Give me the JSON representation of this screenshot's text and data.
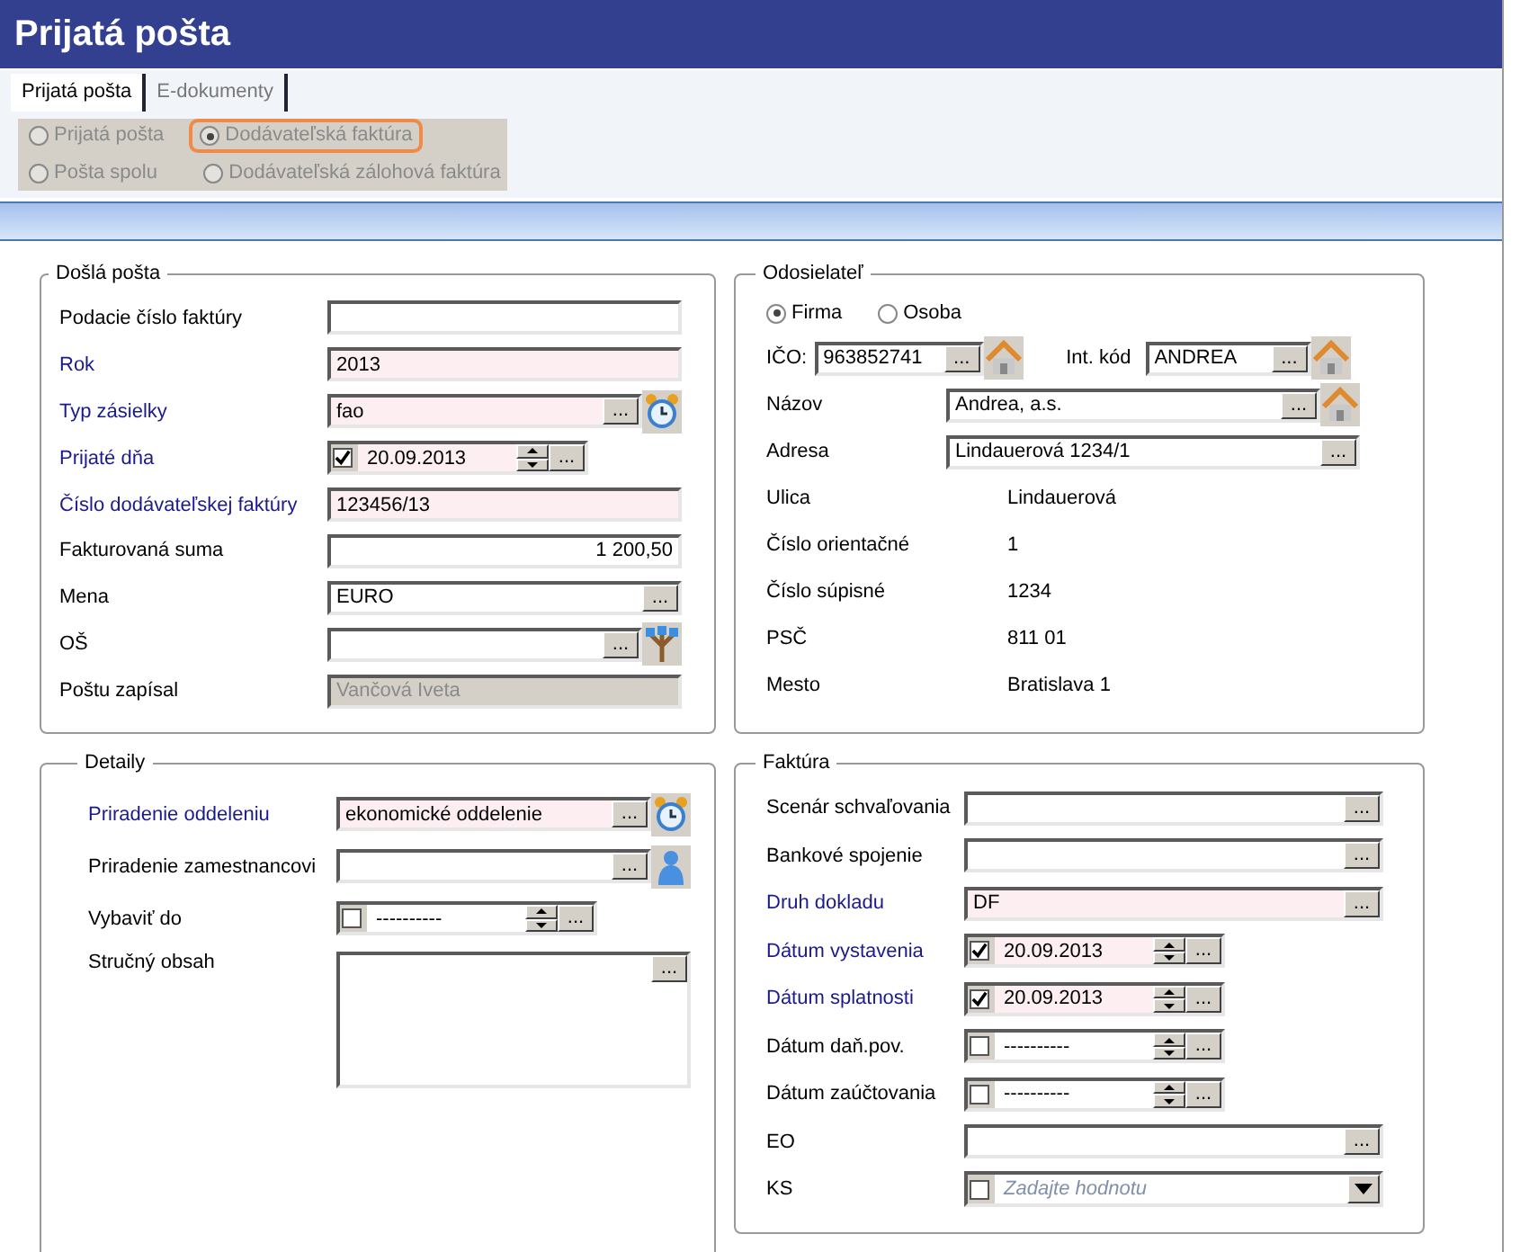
{
  "window": {
    "title": "Prijatá pošta"
  },
  "tabs": [
    {
      "label": "Prijatá pošta",
      "selected": true
    },
    {
      "label": "E-dokumenty",
      "selected": false
    }
  ],
  "doc_types": [
    {
      "label": "Prijatá pošta",
      "selected": false,
      "disabled": true,
      "highlighted": false
    },
    {
      "label": "Dodávateľská faktúra",
      "selected": true,
      "disabled": true,
      "highlighted": true
    },
    {
      "label": "Pošta spolu",
      "selected": false,
      "disabled": true,
      "highlighted": false
    },
    {
      "label": "Dodávateľská zálohová faktúra",
      "selected": false,
      "disabled": true,
      "highlighted": false
    }
  ],
  "panels": [
    {
      "kind": "dosla",
      "title": "Došlá pošta",
      "fields": [
        {
          "kind": "text",
          "label": "Podacie číslo faktúry",
          "required": false
        },
        {
          "kind": "text",
          "label": "Rok",
          "value": "2013",
          "required": true
        },
        {
          "kind": "lookup",
          "label": "Typ zásielky",
          "value": "fao",
          "required": true,
          "button": "..."
        },
        {
          "kind": "date",
          "label": "Prijaté dňa",
          "value": "20.09.2013",
          "checked": true,
          "required": true,
          "button": "..."
        },
        {
          "kind": "text",
          "label": "Číslo dodávateľskej faktúry",
          "value": "123456/13",
          "required": true
        },
        {
          "kind": "amount",
          "label": "Fakturovaná suma",
          "value": "1 200,50",
          "required": false
        },
        {
          "kind": "lookup",
          "label": "Mena",
          "value": "EURO",
          "required": false,
          "button": "..."
        },
        {
          "kind": "lookup",
          "label": "OŠ",
          "required": false,
          "button": "..."
        },
        {
          "kind": "readonly",
          "label": "Poštu zapísal",
          "value": "Vančová Iveta",
          "required": false
        }
      ]
    },
    {
      "kind": "odosielatel",
      "title": "Odosielateľ",
      "fields": [
        {
          "kind": "radios",
          "options": [
            {
              "label": "Firma",
              "selected": true
            },
            {
              "label": "Osoba",
              "selected": false
            }
          ]
        },
        {
          "kind": "pair",
          "items": [
            {
              "label": "IČO:",
              "value": "963852741",
              "button": "..."
            },
            {
              "label": "Int. kód",
              "value": "ANDREA",
              "button": "..."
            }
          ]
        },
        {
          "kind": "lookup",
          "label": "Názov",
          "value": "Andrea, a.s.",
          "required": false,
          "button": "..."
        },
        {
          "kind": "lookup",
          "label": "Adresa",
          "value": "Lindauerová 1234/1",
          "required": false,
          "button": "..."
        },
        {
          "kind": "info",
          "label": "Ulica",
          "value": "Lindauerová"
        },
        {
          "kind": "info",
          "label": "Číslo orientačné",
          "value": "1"
        },
        {
          "kind": "info",
          "label": "Číslo súpisné",
          "value": "1234"
        },
        {
          "kind": "info",
          "label": "PSČ",
          "value": "811 01"
        },
        {
          "kind": "info",
          "label": "Mesto",
          "value": "Bratislava 1"
        }
      ]
    },
    {
      "kind": "detaily",
      "title": "Detaily",
      "fields": [
        {
          "kind": "lookup",
          "label": "Priradenie oddeleniu",
          "value": "ekonomické oddelenie",
          "required": true,
          "button": "..."
        },
        {
          "kind": "lookup",
          "label": "Priradenie zamestnancovi",
          "required": false,
          "button": "..."
        },
        {
          "kind": "date",
          "label": "Vybaviť do",
          "value": "----------",
          "checked": false,
          "required": false,
          "button": "..."
        },
        {
          "kind": "memo",
          "label": "Stručný obsah",
          "required": false,
          "button": "..."
        }
      ]
    },
    {
      "kind": "faktura",
      "title": "Faktúra",
      "fields": [
        {
          "kind": "lookup",
          "label": "Scenár schvaľovania",
          "required": false,
          "button": "..."
        },
        {
          "kind": "lookup",
          "label": "Bankové spojenie",
          "required": false,
          "button": "..."
        },
        {
          "kind": "lookup",
          "label": "Druh dokladu",
          "value": "DF",
          "required": true,
          "button": "..."
        },
        {
          "kind": "date",
          "label": "Dátum vystavenia",
          "value": "20.09.2013",
          "checked": true,
          "required": true,
          "button": "..."
        },
        {
          "kind": "date",
          "label": "Dátum splatnosti",
          "value": "20.09.2013",
          "checked": true,
          "required": true,
          "button": "..."
        },
        {
          "kind": "date",
          "label": "Dátum daň.pov.",
          "value": "----------",
          "checked": false,
          "required": false,
          "button": "..."
        },
        {
          "kind": "date",
          "label": "Dátum zaúčtovania",
          "value": "----------",
          "checked": false,
          "required": false,
          "button": "..."
        },
        {
          "kind": "lookup",
          "label": "EO",
          "required": false,
          "button": "..."
        },
        {
          "kind": "combo",
          "label": "KS",
          "placeholder": "Zadajte hodnotu",
          "checked": false,
          "required": false
        }
      ]
    }
  ]
}
